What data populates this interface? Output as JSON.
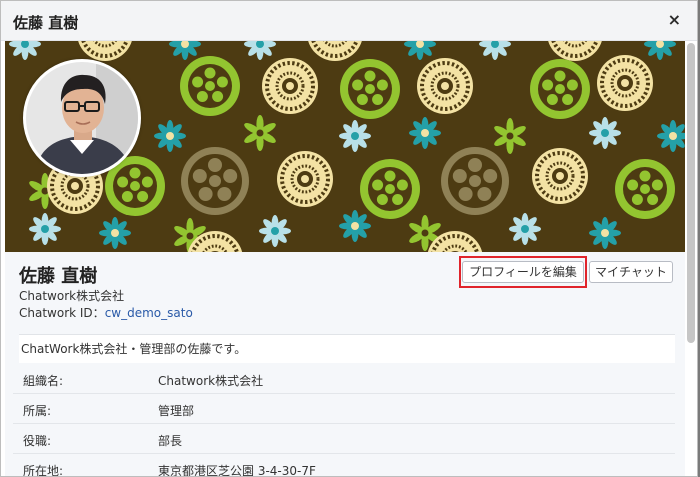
{
  "dialog": {
    "title": "佐藤 直樹",
    "close_label": "×"
  },
  "profile": {
    "name": "佐藤 直樹",
    "company": "Chatwork株式会社",
    "id_label": "Chatwork ID：",
    "id_value": "cw_demo_sato",
    "bio": "ChatWork株式会社・管理部の佐藤です。",
    "avatar_icon": "person-photo"
  },
  "buttons": {
    "edit_profile": "プロフィールを編集",
    "my_chat": "マイチャット"
  },
  "details": [
    {
      "label": "組織名:",
      "value": "Chatwork株式会社"
    },
    {
      "label": "所属:",
      "value": "管理部"
    },
    {
      "label": "役職:",
      "value": "部長"
    },
    {
      "label": "所在地:",
      "value": "東京都港区芝公園 3-4-30-7F"
    }
  ],
  "colors": {
    "highlight": "#e0242b",
    "link": "#2a5aa8",
    "cover_bg": "#4d3b12",
    "cover_lime": "#93c530",
    "cover_teal": "#24a0a8",
    "cover_cream": "#f3e2a4",
    "cover_khaki": "#8f8156"
  }
}
